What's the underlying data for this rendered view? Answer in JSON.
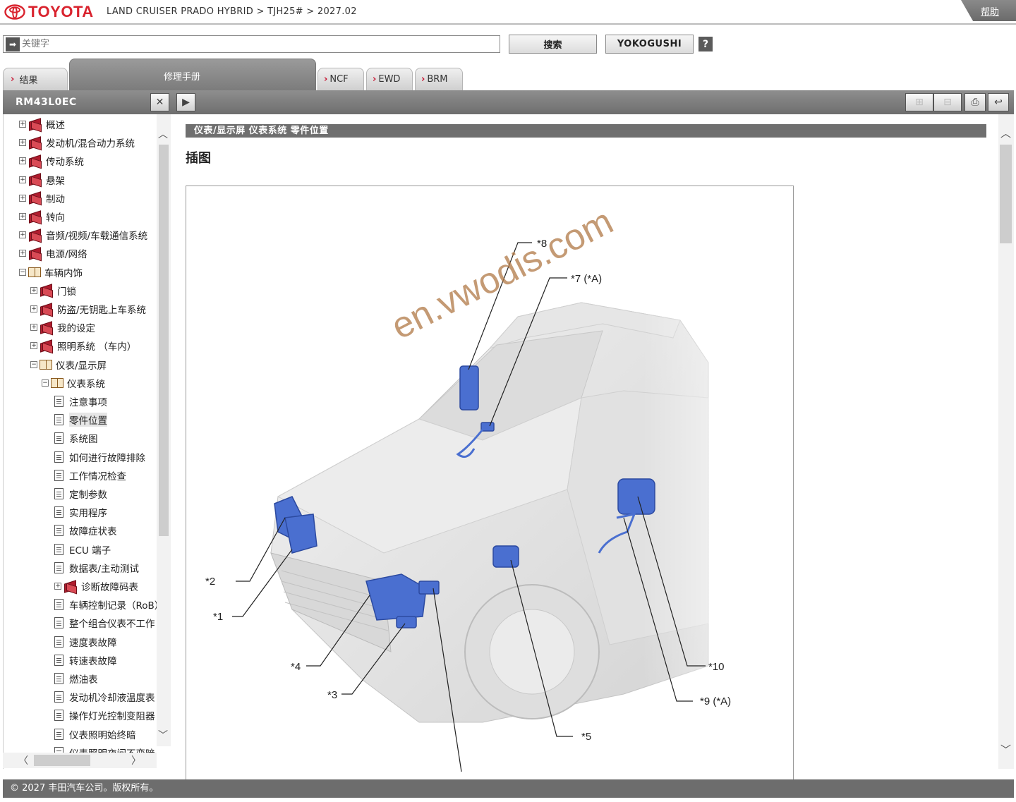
{
  "header": {
    "brand": "TOYOTA",
    "breadcrumb": "LAND CRUISER PRADO HYBRID > TJH25# > 2027.02",
    "help_label": "帮助"
  },
  "search": {
    "placeholder": "关键字",
    "search_label": "搜索",
    "yokogushi_label": "YOKOGUSHI",
    "help_icon": "?"
  },
  "tabs": {
    "results": "结果",
    "manual": "修理手册",
    "ncf": "NCF",
    "ewd": "EWD",
    "brm": "BRM"
  },
  "toolbar": {
    "doc_code": "RM43L0EC"
  },
  "tree": [
    {
      "label": "概述",
      "icon": "book-closed",
      "level": 0,
      "expander": "+"
    },
    {
      "label": "发动机/混合动力系统",
      "icon": "book-closed",
      "level": 0,
      "expander": "+"
    },
    {
      "label": "传动系统",
      "icon": "book-closed",
      "level": 0,
      "expander": "+"
    },
    {
      "label": "悬架",
      "icon": "book-closed",
      "level": 0,
      "expander": "+"
    },
    {
      "label": "制动",
      "icon": "book-closed",
      "level": 0,
      "expander": "+"
    },
    {
      "label": "转向",
      "icon": "book-closed",
      "level": 0,
      "expander": "+"
    },
    {
      "label": "音频/视频/车载通信系统",
      "icon": "book-closed",
      "level": 0,
      "expander": "+"
    },
    {
      "label": "电源/网络",
      "icon": "book-closed",
      "level": 0,
      "expander": "+"
    },
    {
      "label": "车辆内饰",
      "icon": "book-open",
      "level": 0,
      "expander": "−"
    },
    {
      "label": "门锁",
      "icon": "book-closed",
      "level": 1,
      "expander": "+"
    },
    {
      "label": "防盗/无钥匙上车系统",
      "icon": "book-closed",
      "level": 1,
      "expander": "+"
    },
    {
      "label": "我的设定",
      "icon": "book-closed",
      "level": 1,
      "expander": "+"
    },
    {
      "label": "照明系统 （车内）",
      "icon": "book-closed",
      "level": 1,
      "expander": "+"
    },
    {
      "label": "仪表/显示屏",
      "icon": "book-open",
      "level": 1,
      "expander": "−"
    },
    {
      "label": "仪表系统",
      "icon": "book-open",
      "level": 2,
      "expander": "−"
    },
    {
      "label": "注意事项",
      "icon": "doc",
      "level": 3,
      "expander": ""
    },
    {
      "label": "零件位置",
      "icon": "doc",
      "level": 3,
      "expander": "",
      "selected": true
    },
    {
      "label": "系统图",
      "icon": "doc",
      "level": 3,
      "expander": ""
    },
    {
      "label": "如何进行故障排除",
      "icon": "doc",
      "level": 3,
      "expander": ""
    },
    {
      "label": "工作情况检查",
      "icon": "doc",
      "level": 3,
      "expander": ""
    },
    {
      "label": "定制参数",
      "icon": "doc",
      "level": 3,
      "expander": ""
    },
    {
      "label": "实用程序",
      "icon": "doc",
      "level": 3,
      "expander": ""
    },
    {
      "label": "故障症状表",
      "icon": "doc",
      "level": 3,
      "expander": ""
    },
    {
      "label": "ECU 端子",
      "icon": "doc",
      "level": 3,
      "expander": ""
    },
    {
      "label": "数据表/主动测试",
      "icon": "doc",
      "level": 3,
      "expander": ""
    },
    {
      "label": "诊断故障码表",
      "icon": "book-closed",
      "level": 3,
      "expander": "+"
    },
    {
      "label": "车辆控制记录（RoB）",
      "icon": "doc",
      "level": 3,
      "expander": ""
    },
    {
      "label": "整个组合仪表不工作",
      "icon": "doc",
      "level": 3,
      "expander": ""
    },
    {
      "label": "速度表故障",
      "icon": "doc",
      "level": 3,
      "expander": ""
    },
    {
      "label": "转速表故障",
      "icon": "doc",
      "level": 3,
      "expander": ""
    },
    {
      "label": "燃油表",
      "icon": "doc",
      "level": 3,
      "expander": ""
    },
    {
      "label": "发动机冷却液温度表",
      "icon": "doc",
      "level": 3,
      "expander": ""
    },
    {
      "label": "操作灯光控制变阻器",
      "icon": "doc",
      "level": 3,
      "expander": ""
    },
    {
      "label": "仪表照明始终暗",
      "icon": "doc",
      "level": 3,
      "expander": ""
    },
    {
      "label": "仪表照明夜间不变暗",
      "icon": "doc",
      "level": 3,
      "expander": ""
    }
  ],
  "content": {
    "section_path": "仪表/显示屏  仪表系统  零件位置",
    "title": "插图",
    "callouts": [
      "*8",
      "*7 (*A)",
      "*2",
      "*1",
      "*4",
      "*3",
      "*5",
      "*10",
      "*9 (*A)"
    ],
    "watermark": "en.vwodis.com"
  },
  "footer": {
    "copyright": "© 2027 丰田汽车公司。版权所有。"
  },
  "colors": {
    "brand_red": "#d9232e",
    "toolbar_gray": "#7a7a7a",
    "part_blue": "#4a6fd0"
  }
}
